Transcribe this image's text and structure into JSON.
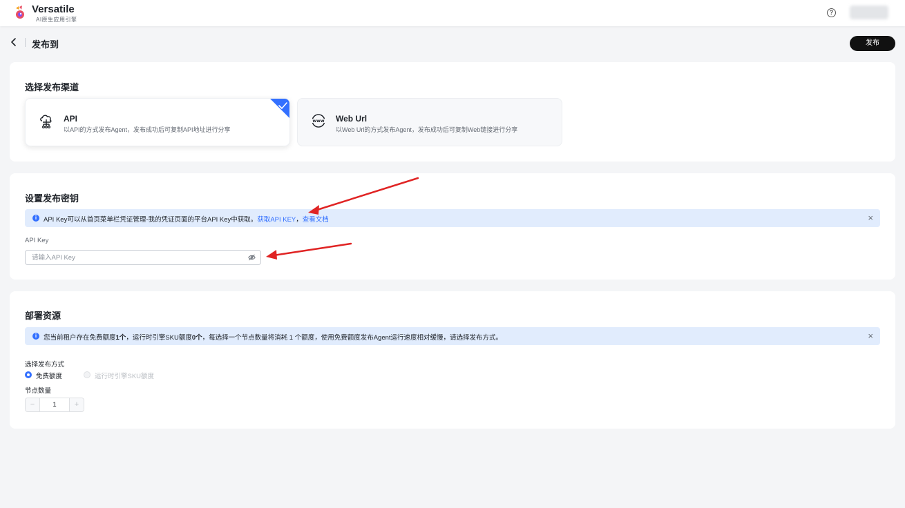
{
  "brand": {
    "name": "Versatile",
    "subtitle": "AI原生应用引擎"
  },
  "header": {
    "help_icon": "?",
    "title": "发布到",
    "publish_label": "发布"
  },
  "channel_section": {
    "title": "选择发布渠道",
    "cards": [
      {
        "title": "API",
        "desc": "以API的方式发布Agent，发布成功后可复制API地址进行分享",
        "selected": true,
        "icon": "cloud-network-icon"
      },
      {
        "title": "Web Url",
        "desc": "以Web Url的方式发布Agent，发布成功后可复制Web链接进行分享",
        "selected": false,
        "icon": "www-globe-icon"
      }
    ]
  },
  "key_section": {
    "title": "设置发布密钥",
    "alert_text": "API Key可以从首页菜单栏凭证管理-我的凭证页面的平台API Key中获取。",
    "alert_link_1": "获取API KEY",
    "alert_sep": "，",
    "alert_link_2": "查看文档",
    "field_label": "API Key",
    "input_placeholder": "请输入API Key",
    "input_value": ""
  },
  "resource_section": {
    "title": "部署资源",
    "alert_prefix": "您当前租户存在免费额度",
    "alert_free_count": "1个",
    "alert_mid": "，运行时引擎SKU额度",
    "alert_sku_count": "0个",
    "alert_suffix": "，每选择一个节点数量将消耗 1 个额度，使用免费额度发布Agent运行速度相对缓慢，请选择发布方式。",
    "method_label": "选择发布方式",
    "options": [
      {
        "label": "免费额度",
        "checked": true,
        "disabled": false
      },
      {
        "label": "运行时引擎SKU额度",
        "checked": false,
        "disabled": true
      }
    ],
    "node_label": "节点数量",
    "stepper": {
      "minus": "−",
      "value": "1",
      "plus": "+"
    }
  },
  "colors": {
    "primary": "#3370ff",
    "alert_bg": "#e1ecfd",
    "annotation_arrow": "#e02424",
    "dark_button": "#111111"
  }
}
